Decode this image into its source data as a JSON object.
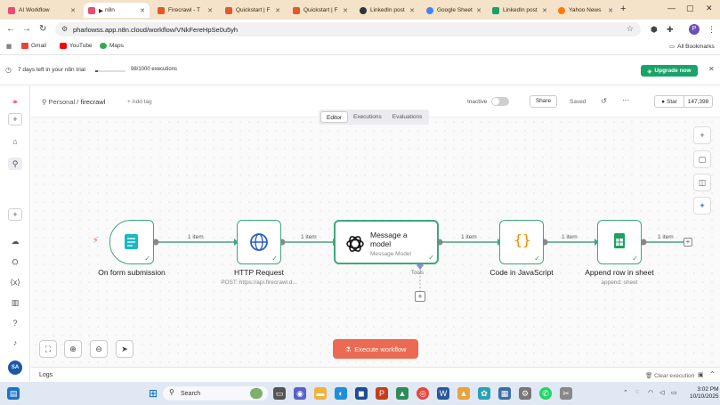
{
  "browser": {
    "tabs": [
      {
        "label": "AI Workflow",
        "color": "#ea4b71"
      },
      {
        "label": "n8n",
        "color": "#ea4b71"
      },
      {
        "label": "Firecrawl - T",
        "color": "#e05a2b"
      },
      {
        "label": "Quickstart | F",
        "color": "#e05a2b"
      },
      {
        "label": "Quickstart | F",
        "color": "#e05a2b"
      },
      {
        "label": "LinkedIn post",
        "color": "#333333"
      },
      {
        "label": "Google Sheet",
        "color": "#4285f4"
      },
      {
        "label": "LinkedIn post",
        "color": "#1aa260"
      },
      {
        "label": "Yahoo News",
        "color": "#ff7a00"
      }
    ],
    "url": "pharlowss.app.n8n.cloud/workflow/VNkFereHpSe0u5yh",
    "bookmarks": [
      "Gmail",
      "YouTube",
      "Maps"
    ],
    "all_bookmarks": "All Bookmarks",
    "profile_initial": "P"
  },
  "trial": {
    "days_left": "7 days left in your n8n trial",
    "executions": "98/1000 executions",
    "progress_fraction": 0.098,
    "upgrade_label": "Upgrade now"
  },
  "header": {
    "project": "Personal",
    "workflow_name": "firecrawl",
    "add_tag": "+ Add tag",
    "status": "Inactive",
    "share": "Share",
    "saved": "Saved",
    "star": "Star",
    "star_count": "147,398"
  },
  "view_tabs": [
    "Editor",
    "Executions",
    "Evaluations"
  ],
  "nodes": [
    {
      "name": "On form submission",
      "subtitle": ""
    },
    {
      "name": "HTTP Request",
      "subtitle": "POST: https://api.firecrawl.d..."
    },
    {
      "name": "Message a model",
      "subtitle": "Message Model"
    },
    {
      "name": "Code in JavaScript",
      "subtitle": ""
    },
    {
      "name": "Append row in sheet",
      "subtitle": "append: sheet"
    }
  ],
  "edge_label": "1 item",
  "tools_label": "Tools",
  "execute_label": "Execute workflow",
  "logs": {
    "title": "Logs",
    "clear": "Clear execution"
  },
  "taskbar": {
    "search_placeholder": "Search",
    "time": "3:02 PM",
    "date": "10/10/2025"
  },
  "user_initials": "SA"
}
